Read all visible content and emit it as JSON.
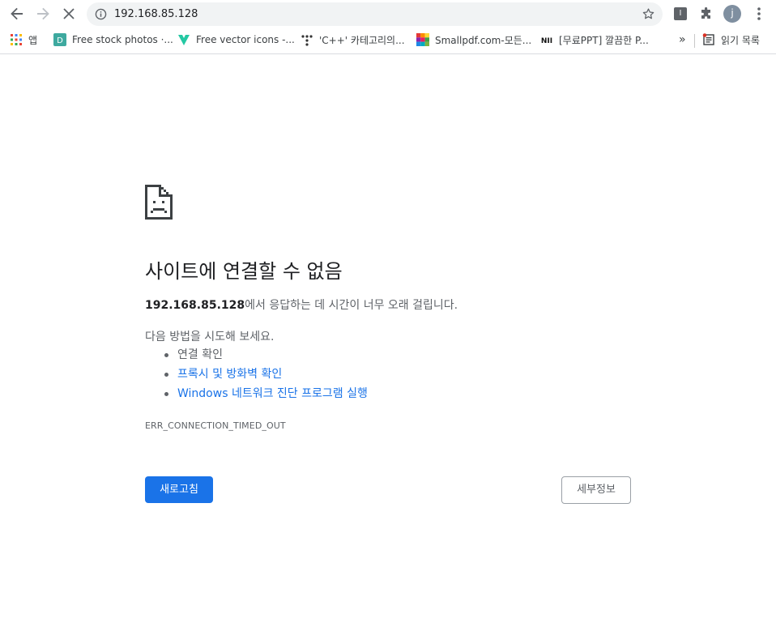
{
  "toolbar": {
    "url": "192.168.85.128",
    "extension_label": "I",
    "profile_initial": "j"
  },
  "bookmarks": {
    "items": [
      {
        "label": "앱",
        "icon": "apps-grid-icon"
      },
      {
        "label": "Free stock photos ·...",
        "icon": "teal-d-icon"
      },
      {
        "label": "Free vector icons -...",
        "icon": "green-v-icon"
      },
      {
        "label": "'C++' 카테고리의...",
        "icon": "dots-icon"
      },
      {
        "label": "Smallpdf.com-모든...",
        "icon": "smallpdf-icon"
      },
      {
        "label": "[무료PPT] 깔끔한 P...",
        "icon": "nii-icon"
      }
    ],
    "overflow": "»",
    "reading_list": "읽기 목록"
  },
  "error": {
    "title": "사이트에 연결할 수 없음",
    "host": "192.168.85.128",
    "description_suffix": "에서 응답하는 데 시간이 너무 오래 걸립니다.",
    "suggestions_intro": "다음 방법을 시도해 보세요.",
    "suggestions": [
      {
        "text": "연결 확인",
        "link": false
      },
      {
        "text": "프록시 및 방화벽 확인",
        "link": true
      },
      {
        "text": "Windows 네트워크 진단 프로그램 실행",
        "link": true
      }
    ],
    "code": "ERR_CONNECTION_TIMED_OUT",
    "reload_label": "새로고침",
    "details_label": "세부정보"
  },
  "colors": {
    "accent": "#1a73e8",
    "text_secondary": "#5f6368",
    "omnibox_bg": "#f1f3f4"
  }
}
